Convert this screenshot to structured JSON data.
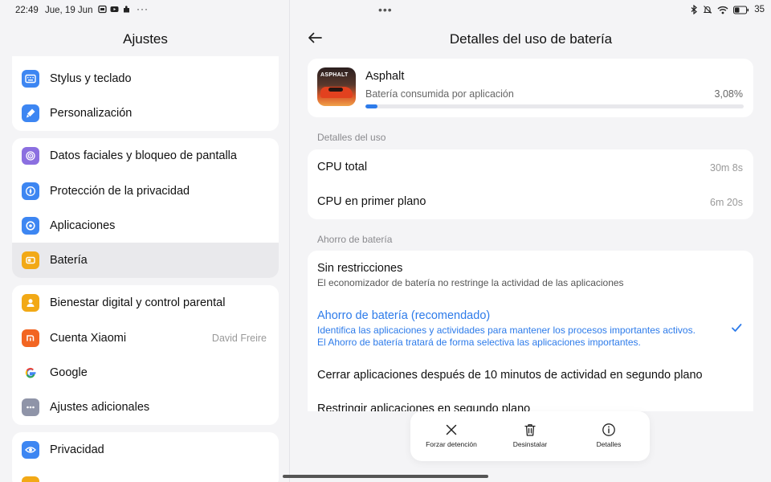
{
  "status_bar": {
    "time": "22:49",
    "date": "Jue, 19 Jun",
    "overflow": "···",
    "battery_percent": "35"
  },
  "left_pane": {
    "title": "Ajustes",
    "groups": [
      {
        "items": [
          {
            "label": "Stylus y teclado",
            "icon": "keyboard-icon",
            "color": "#3d86f2"
          },
          {
            "label": "Personalización",
            "icon": "brush-icon",
            "color": "#3d86f2"
          }
        ]
      },
      {
        "items": [
          {
            "label": "Datos faciales y bloqueo de pantalla",
            "icon": "fingerprint-icon",
            "color": "#8b6fe0"
          },
          {
            "label": "Protección de la privacidad",
            "icon": "compass-icon",
            "color": "#3d86f2"
          },
          {
            "label": "Aplicaciones",
            "icon": "apps-gear-icon",
            "color": "#3d86f2"
          },
          {
            "label": "Batería",
            "icon": "battery-icon",
            "color": "#f2a916",
            "active": true
          }
        ]
      },
      {
        "items": [
          {
            "label": "Bienestar digital y control parental",
            "icon": "wellbeing-icon",
            "color": "#f2a916"
          },
          {
            "label": "Cuenta Xiaomi",
            "icon": "xiaomi-icon",
            "color": "#f26522",
            "value": "David Freire"
          },
          {
            "label": "Google",
            "icon": "google-icon",
            "color": "#ffffff"
          },
          {
            "label": "Ajustes adicionales",
            "icon": "more-icon",
            "color": "#8f94a8"
          }
        ]
      },
      {
        "items": [
          {
            "label": "Privacidad",
            "icon": "eye-icon",
            "color": "#3d86f2"
          }
        ]
      }
    ]
  },
  "right_pane": {
    "title": "Detalles del uso de batería",
    "app": {
      "name": "Asphalt",
      "logo_text": "ASPHALT",
      "usage_label": "Batería consumida por aplicación",
      "usage_percent": "3,08%",
      "usage_fraction": 0.0308
    },
    "usage_section_label": "Detalles del uso",
    "usage_rows": [
      {
        "label": "CPU total",
        "value": "30m 8s"
      },
      {
        "label": "CPU en primer plano",
        "value": "6m 20s"
      }
    ],
    "saver_section_label": "Ahorro de batería",
    "saver_options": [
      {
        "title": "Sin restricciones",
        "desc": "El economizador de batería no restringe la actividad de las aplicaciones",
        "selected": false
      },
      {
        "title": "Ahorro de batería (recomendado)",
        "desc1": "Identifica las aplicaciones y actividades para mantener los procesos importantes activos.",
        "desc2": "El Ahorro de batería tratará de forma selectiva las aplicaciones importantes.",
        "selected": true
      },
      {
        "title": "Cerrar aplicaciones después de 10 minutos de actividad en segundo plano",
        "selected": false
      },
      {
        "title": "Restringir aplicaciones en segundo plano",
        "selected": false
      }
    ]
  },
  "action_bar": {
    "force_stop": "Forzar detención",
    "uninstall": "Desinstalar",
    "details": "Detalles"
  },
  "colors": {
    "accent": "#2d7bea",
    "active_row": "#e9e9ec",
    "background": "#f4f4f6"
  }
}
